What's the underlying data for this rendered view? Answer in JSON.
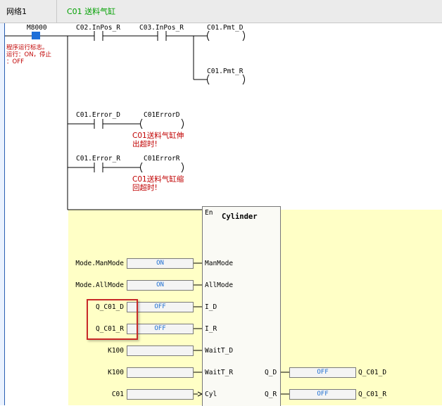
{
  "header": {
    "network_label": "网络1",
    "network_title": "C01 送料气缸"
  },
  "contacts": {
    "m8000": "M8000",
    "c02_inpos_r": "C02.InPos_R",
    "c03_inpos_r": "C03.InPos_R",
    "c01_error_d": "C01.Error_D",
    "c01_error_r": "C01.Error_R"
  },
  "coils": {
    "c01_pmt_d": "C01.Pmt_D",
    "c01_pmt_r": "C01.Pmt_R",
    "c01errord": "C01ErrorD",
    "c01errorr": "C01ErrorR"
  },
  "comments": {
    "m8000_line1": "程序运行标志。",
    "m8000_line2": "运行：ON，停止",
    "m8000_line3": "：OFF",
    "errord_line1": "C01送料气缸伸",
    "errord_line2": "出超时!",
    "errorr_line1": "C01送料气缸缩",
    "errorr_line2": "回超时!"
  },
  "function_block": {
    "en_label": "En",
    "title": "Cylinder",
    "inputs": [
      {
        "pin": "ManMode",
        "operand": "Mode.ManMode",
        "value": "ON"
      },
      {
        "pin": "AllMode",
        "operand": "Mode.AllMode",
        "value": "ON"
      },
      {
        "pin": "I_D",
        "operand": "Q_C01_D",
        "value": "OFF"
      },
      {
        "pin": "I_R",
        "operand": "Q_C01_R",
        "value": "OFF"
      },
      {
        "pin": "WaitT_D",
        "operand": "K100",
        "value": ""
      },
      {
        "pin": "WaitT_R",
        "operand": "K100",
        "value": ""
      },
      {
        "pin": "Cyl",
        "operand": "C01",
        "value": ""
      }
    ],
    "outputs": [
      {
        "pin": "Q_D",
        "operand": "Q_C01_D",
        "value": "OFF"
      },
      {
        "pin": "Q_R",
        "operand": "Q_C01_R",
        "value": "OFF"
      }
    ]
  },
  "colors": {
    "value_text": "#1f6fd1",
    "comment_text": "#c00000",
    "title_text": "#00a000",
    "highlight": "#c82828",
    "block_background": "#ffffc6"
  }
}
